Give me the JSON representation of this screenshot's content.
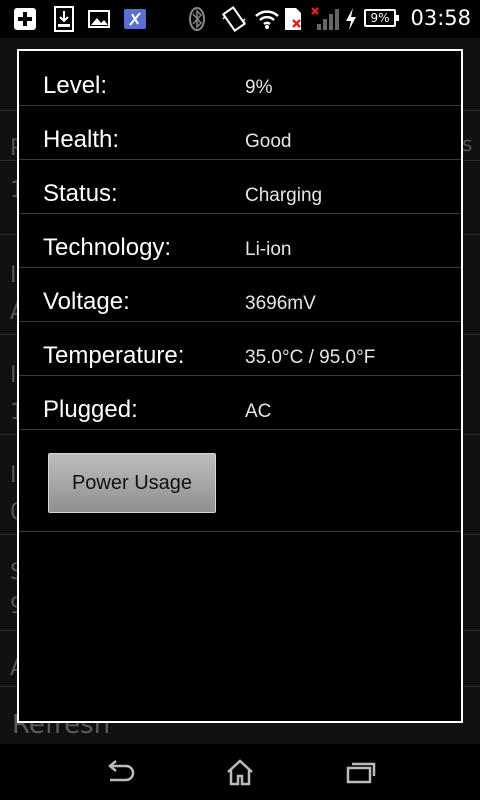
{
  "status_bar": {
    "time": "03:58",
    "battery_percent": "9%",
    "icons": [
      "add-icon",
      "download-icon",
      "image-icon",
      "app-icon",
      "bluetooth-icon",
      "vibrate-icon",
      "wifi-icon",
      "sim-error-icon",
      "signal-icon",
      "charging-icon",
      "battery-icon"
    ]
  },
  "background": {
    "left_chars": [
      "P",
      "1",
      "I",
      "A",
      "I",
      "1",
      "I",
      "0",
      "S",
      "9",
      "A"
    ],
    "right_fragment": "s",
    "refresh_label": "Refresh"
  },
  "dialog": {
    "rows": [
      {
        "label": "Level:",
        "value": "9%"
      },
      {
        "label": "Health:",
        "value": "Good"
      },
      {
        "label": "Status:",
        "value": "Charging"
      },
      {
        "label": "Technology:",
        "value": "Li-ion"
      },
      {
        "label": "Voltage:",
        "value": "3696mV"
      },
      {
        "label": "Temperature:",
        "value": "35.0°C / 95.0°F"
      },
      {
        "label": "Plugged:",
        "value": "AC"
      }
    ],
    "button_label": "Power Usage"
  },
  "nav_bar": {
    "icons": [
      "back-icon",
      "home-icon",
      "recent-apps-icon"
    ]
  },
  "colors": {
    "background": "#000000",
    "dialog_border": "#ffffff",
    "button_gradient_top": "#bdbdbd",
    "button_gradient_bottom": "#8f8f8f"
  }
}
